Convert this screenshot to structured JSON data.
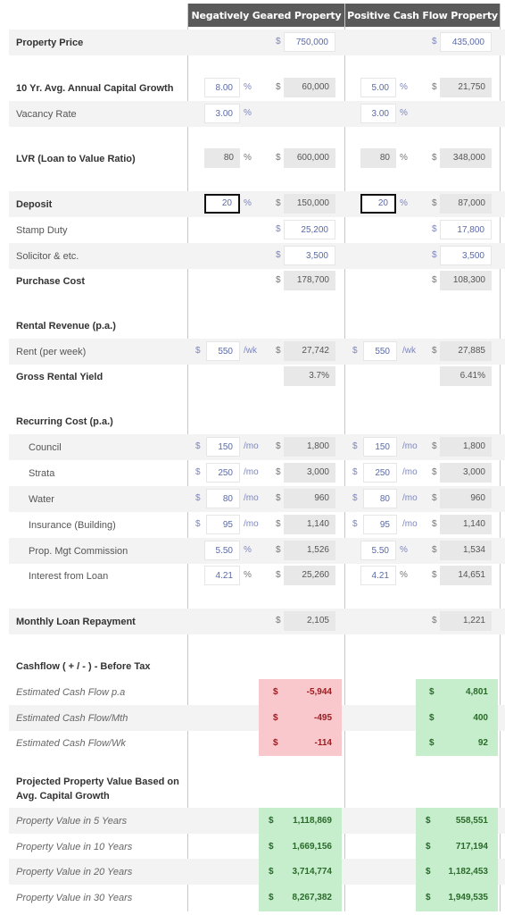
{
  "headers": {
    "negative": "Negatively Geared Property",
    "positive": "Positive Cash Flow Property"
  },
  "currency": "$",
  "rows": {
    "property_price": {
      "label": "Property Price",
      "neg": "750,000",
      "pos": "435,000"
    },
    "capital_growth": {
      "label": "10 Yr. Avg. Annual Capital Growth",
      "neg_pct": "8.00",
      "neg_amt": "60,000",
      "pos_pct": "5.00",
      "pos_amt": "21,750"
    },
    "vacancy": {
      "label": "Vacancy Rate",
      "neg_pct": "3.00",
      "pos_pct": "3.00"
    },
    "lvr": {
      "label": "LVR (Loan to Value Ratio)",
      "neg_pct": "80",
      "neg_amt": "600,000",
      "pos_pct": "80",
      "pos_amt": "348,000"
    },
    "deposit": {
      "label": "Deposit",
      "neg_pct": "20",
      "neg_amt": "150,000",
      "pos_pct": "20",
      "pos_amt": "87,000"
    },
    "stamp_duty": {
      "label": "Stamp Duty",
      "neg": "25,200",
      "pos": "17,800"
    },
    "solicitor": {
      "label": "Solicitor & etc.",
      "neg": "3,500",
      "pos": "3,500"
    },
    "purchase_cost": {
      "label": "Purchase Cost",
      "neg": "178,700",
      "pos": "108,300"
    },
    "rental_revenue": {
      "label": "Rental Revenue (p.a.)"
    },
    "rent": {
      "label": "Rent (per week)",
      "neg_in": "550",
      "neg_amt": "27,742",
      "pos_in": "550",
      "pos_amt": "27,885"
    },
    "gross_yield": {
      "label": "Gross Rental Yield",
      "neg": "3.7%",
      "pos": "6.41%"
    },
    "recurring": {
      "label": "Recurring Cost (p.a.)"
    },
    "council": {
      "label": "Council",
      "neg_in": "150",
      "neg_amt": "1,800",
      "pos_in": "150",
      "pos_amt": "1,800"
    },
    "strata": {
      "label": "Strata",
      "neg_in": "250",
      "neg_amt": "3,000",
      "pos_in": "250",
      "pos_amt": "3,000"
    },
    "water": {
      "label": "Water",
      "neg_in": "80",
      "neg_amt": "960",
      "pos_in": "80",
      "pos_amt": "960"
    },
    "insurance": {
      "label": "Insurance (Building)",
      "neg_in": "95",
      "neg_amt": "1,140",
      "pos_in": "95",
      "pos_amt": "1,140"
    },
    "mgt": {
      "label": "Prop. Mgt Commission",
      "neg_pct": "5.50",
      "neg_amt": "1,526",
      "pos_pct": "5.50",
      "pos_amt": "1,534"
    },
    "interest": {
      "label": "Interest from Loan",
      "neg_pct": "4.21",
      "neg_amt": "25,260",
      "pos_pct": "4.21",
      "pos_amt": "14,651"
    },
    "monthly_repay": {
      "label": "Monthly Loan Repayment",
      "neg": "2,105",
      "pos": "1,221"
    },
    "cashflow": {
      "label": "Cashflow ( + / - ) - Before Tax"
    },
    "cf_pa": {
      "label": "Estimated Cash Flow p.a",
      "neg": "-5,944",
      "pos": "4,801"
    },
    "cf_mth": {
      "label": "Estimated Cash Flow/Mth",
      "neg": "-495",
      "pos": "400"
    },
    "cf_wk": {
      "label": "Estimated Cash Flow/Wk",
      "neg": "-114",
      "pos": "92"
    },
    "projected": {
      "label1": "Projected Property Value Based on",
      "label2": "Avg. Capital Growth"
    },
    "pv5": {
      "label": "Property Value in 5 Years",
      "neg": "1,118,869",
      "pos": "558,551"
    },
    "pv10": {
      "label": "Property Value in 10 Years",
      "neg": "1,669,156",
      "pos": "717,194"
    },
    "pv20": {
      "label": "Property Value in 20 Years",
      "neg": "3,714,774",
      "pos": "1,182,453"
    },
    "pv30": {
      "label": "Property Value in 30 Years",
      "neg": "8,267,382",
      "pos": "1,949,535"
    }
  },
  "units": {
    "percent": "%",
    "per_week": "/wk",
    "per_month": "/mo"
  },
  "colors": {
    "header_bg": "#5a5a5a",
    "negative_bg": "#f8c8cc",
    "positive_bg": "#c6eecc"
  }
}
